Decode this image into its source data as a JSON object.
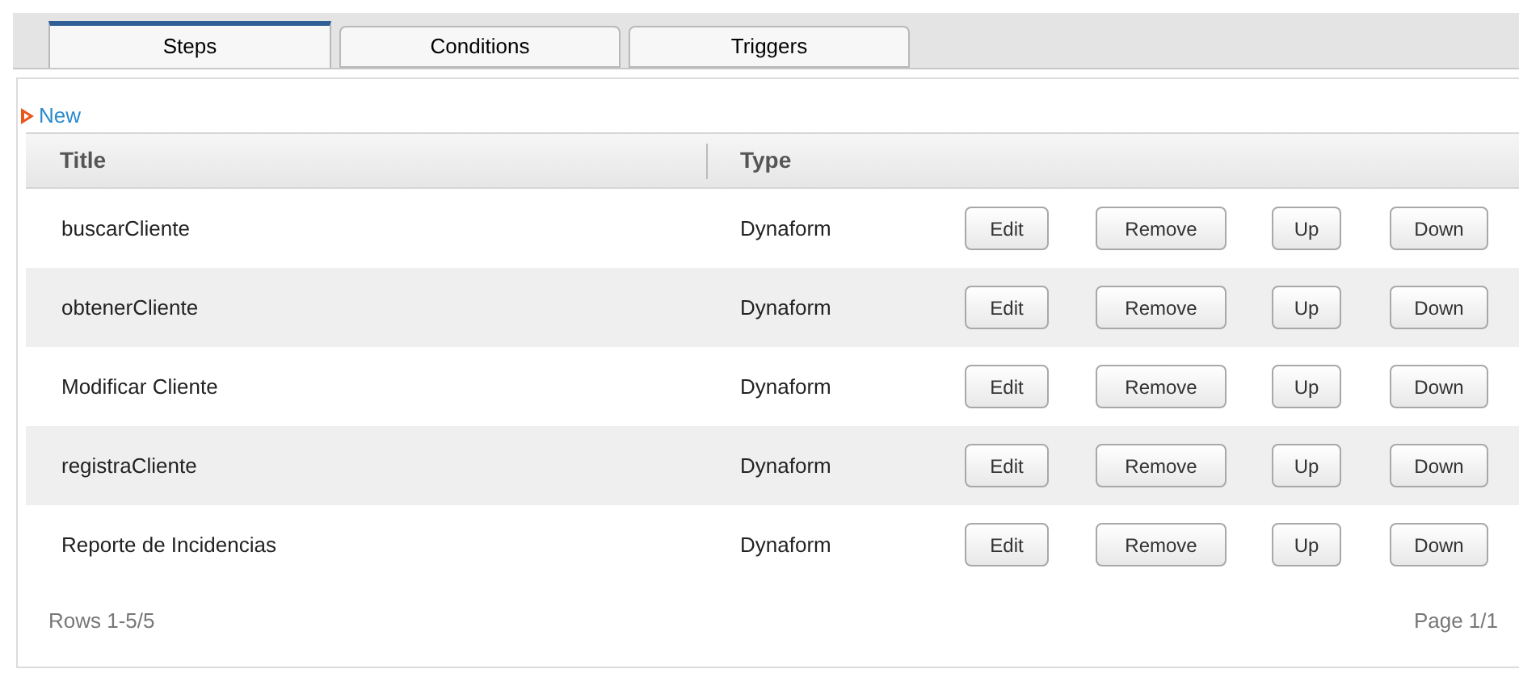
{
  "tabs": [
    {
      "label": "Steps",
      "selected": true
    },
    {
      "label": "Conditions",
      "selected": false
    },
    {
      "label": "Triggers",
      "selected": false
    }
  ],
  "new_link": "New",
  "table": {
    "columns": [
      "Title",
      "Type"
    ],
    "rows": [
      {
        "title": "buscarCliente",
        "type": "Dynaform",
        "actions": [
          "Edit",
          "Remove",
          "Up",
          "Down"
        ]
      },
      {
        "title": "obtenerCliente",
        "type": "Dynaform",
        "actions": [
          "Edit",
          "Remove",
          "Up",
          "Down"
        ]
      },
      {
        "title": "Modificar Cliente",
        "type": "Dynaform",
        "actions": [
          "Edit",
          "Remove",
          "Up",
          "Down"
        ]
      },
      {
        "title": "registraCliente",
        "type": "Dynaform",
        "actions": [
          "Edit",
          "Remove",
          "Up",
          "Down"
        ]
      },
      {
        "title": "Reporte de Incidencias",
        "type": "Dynaform",
        "actions": [
          "Edit",
          "Remove",
          "Up",
          "Down"
        ]
      }
    ]
  },
  "footer": {
    "rows": "Rows 1-5/5",
    "page": "Page 1/1"
  }
}
